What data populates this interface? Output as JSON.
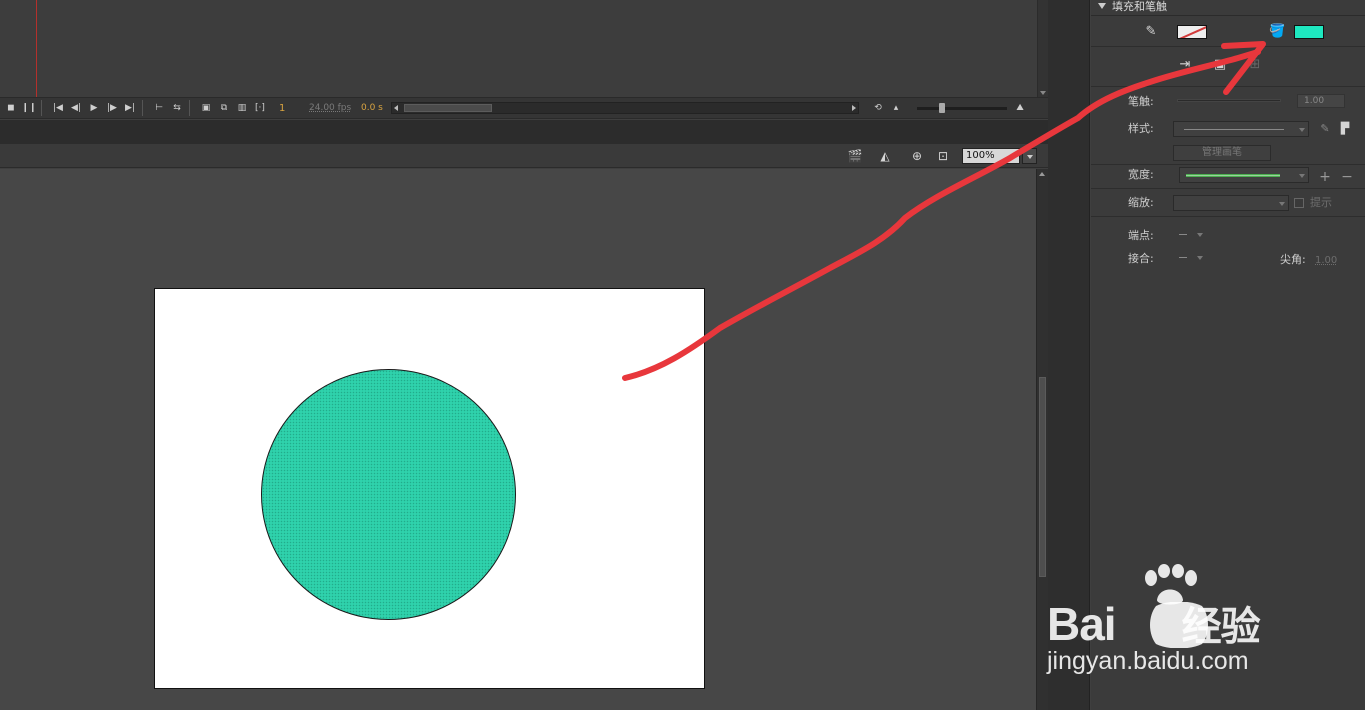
{
  "timeline": {
    "frame_number": "1",
    "fps": "24.00 fps",
    "elapsed": "0.0 s"
  },
  "stage": {
    "zoom": "100%"
  },
  "properties": {
    "section_title": "填充和笔触",
    "stroke_label": "笔触:",
    "stroke_value": "1.00",
    "style_label": "样式:",
    "manage_brush": "管理画笔",
    "width_label": "宽度:",
    "scale_label": "缩放:",
    "hint_label": "提示",
    "cap_label": "端点:",
    "join_label": "接合:",
    "miter_label": "尖角:",
    "miter_value": "1.00"
  },
  "colors": {
    "fill": "#1ee8c0",
    "circle_fill": "#2fd2ac",
    "annotation": "#e8373c",
    "width_line": "#4caf50"
  },
  "icons": {
    "stroke": "pencil-icon",
    "fill": "paint-bucket-icon"
  },
  "watermark": {
    "brand": "Bai",
    "brand_suffix": "经验",
    "url": "jingyan.baidu.com"
  }
}
